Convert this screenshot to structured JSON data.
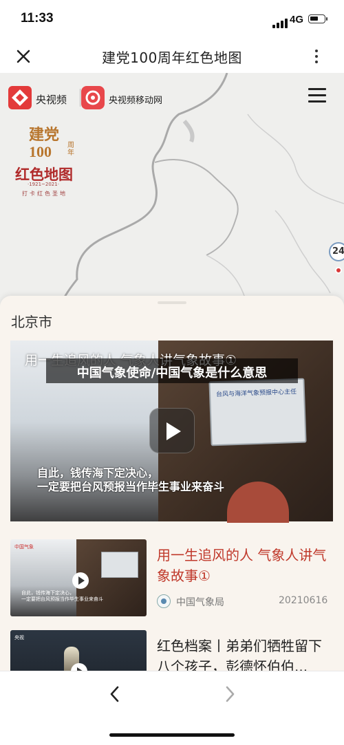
{
  "status": {
    "time": "11:33",
    "network": "4G"
  },
  "nav": {
    "title": "建党100周年红色地图"
  },
  "map": {
    "logo_left": "央视频",
    "logo_right": "央视频移动网",
    "emblem": {
      "line1": "建党",
      "line2": "100",
      "line2_suffix": "周年",
      "line3": "红色地图",
      "years": "·1921~2021·",
      "subtitle": "打卡红色圣地"
    },
    "pin_label": "24"
  },
  "sheet": {
    "city": "北京市",
    "featured": {
      "title": "用一生追风的人 气象人讲气象故事①",
      "subtitle_line1": "自此，钱传海下定决心，",
      "subtitle_line2": "一定要把台风预报当作毕生事业来奋斗",
      "sign_text": "台风与海洋气象预报中心主任"
    },
    "caption_overlay": "中国气象使命/中国气象是什么意思",
    "items": [
      {
        "title": "用一生追风的人 气象人讲气象故事①",
        "source": "中国气象局",
        "date": "20210616",
        "thumb_logo": "中国气象",
        "thumb_sub1": "自此，钱传海下定决心，",
        "thumb_sub2": "一定要把台风预报当作毕生事业来奋斗"
      },
      {
        "title": "红色档案丨弟弟们牺牲留下八个孩子，彭德怀伯伯...",
        "thumb_logo": "央视"
      }
    ]
  },
  "colors": {
    "accent_red": "#c0392b",
    "sheet_bg": "#f9f4ee",
    "map_bg": "#efefed"
  },
  "icons": {
    "close": "close-icon",
    "more": "more-vertical-icon",
    "menu": "hamburger-menu-icon",
    "play": "play-icon",
    "back": "chevron-left-icon",
    "forward": "chevron-right-icon"
  }
}
